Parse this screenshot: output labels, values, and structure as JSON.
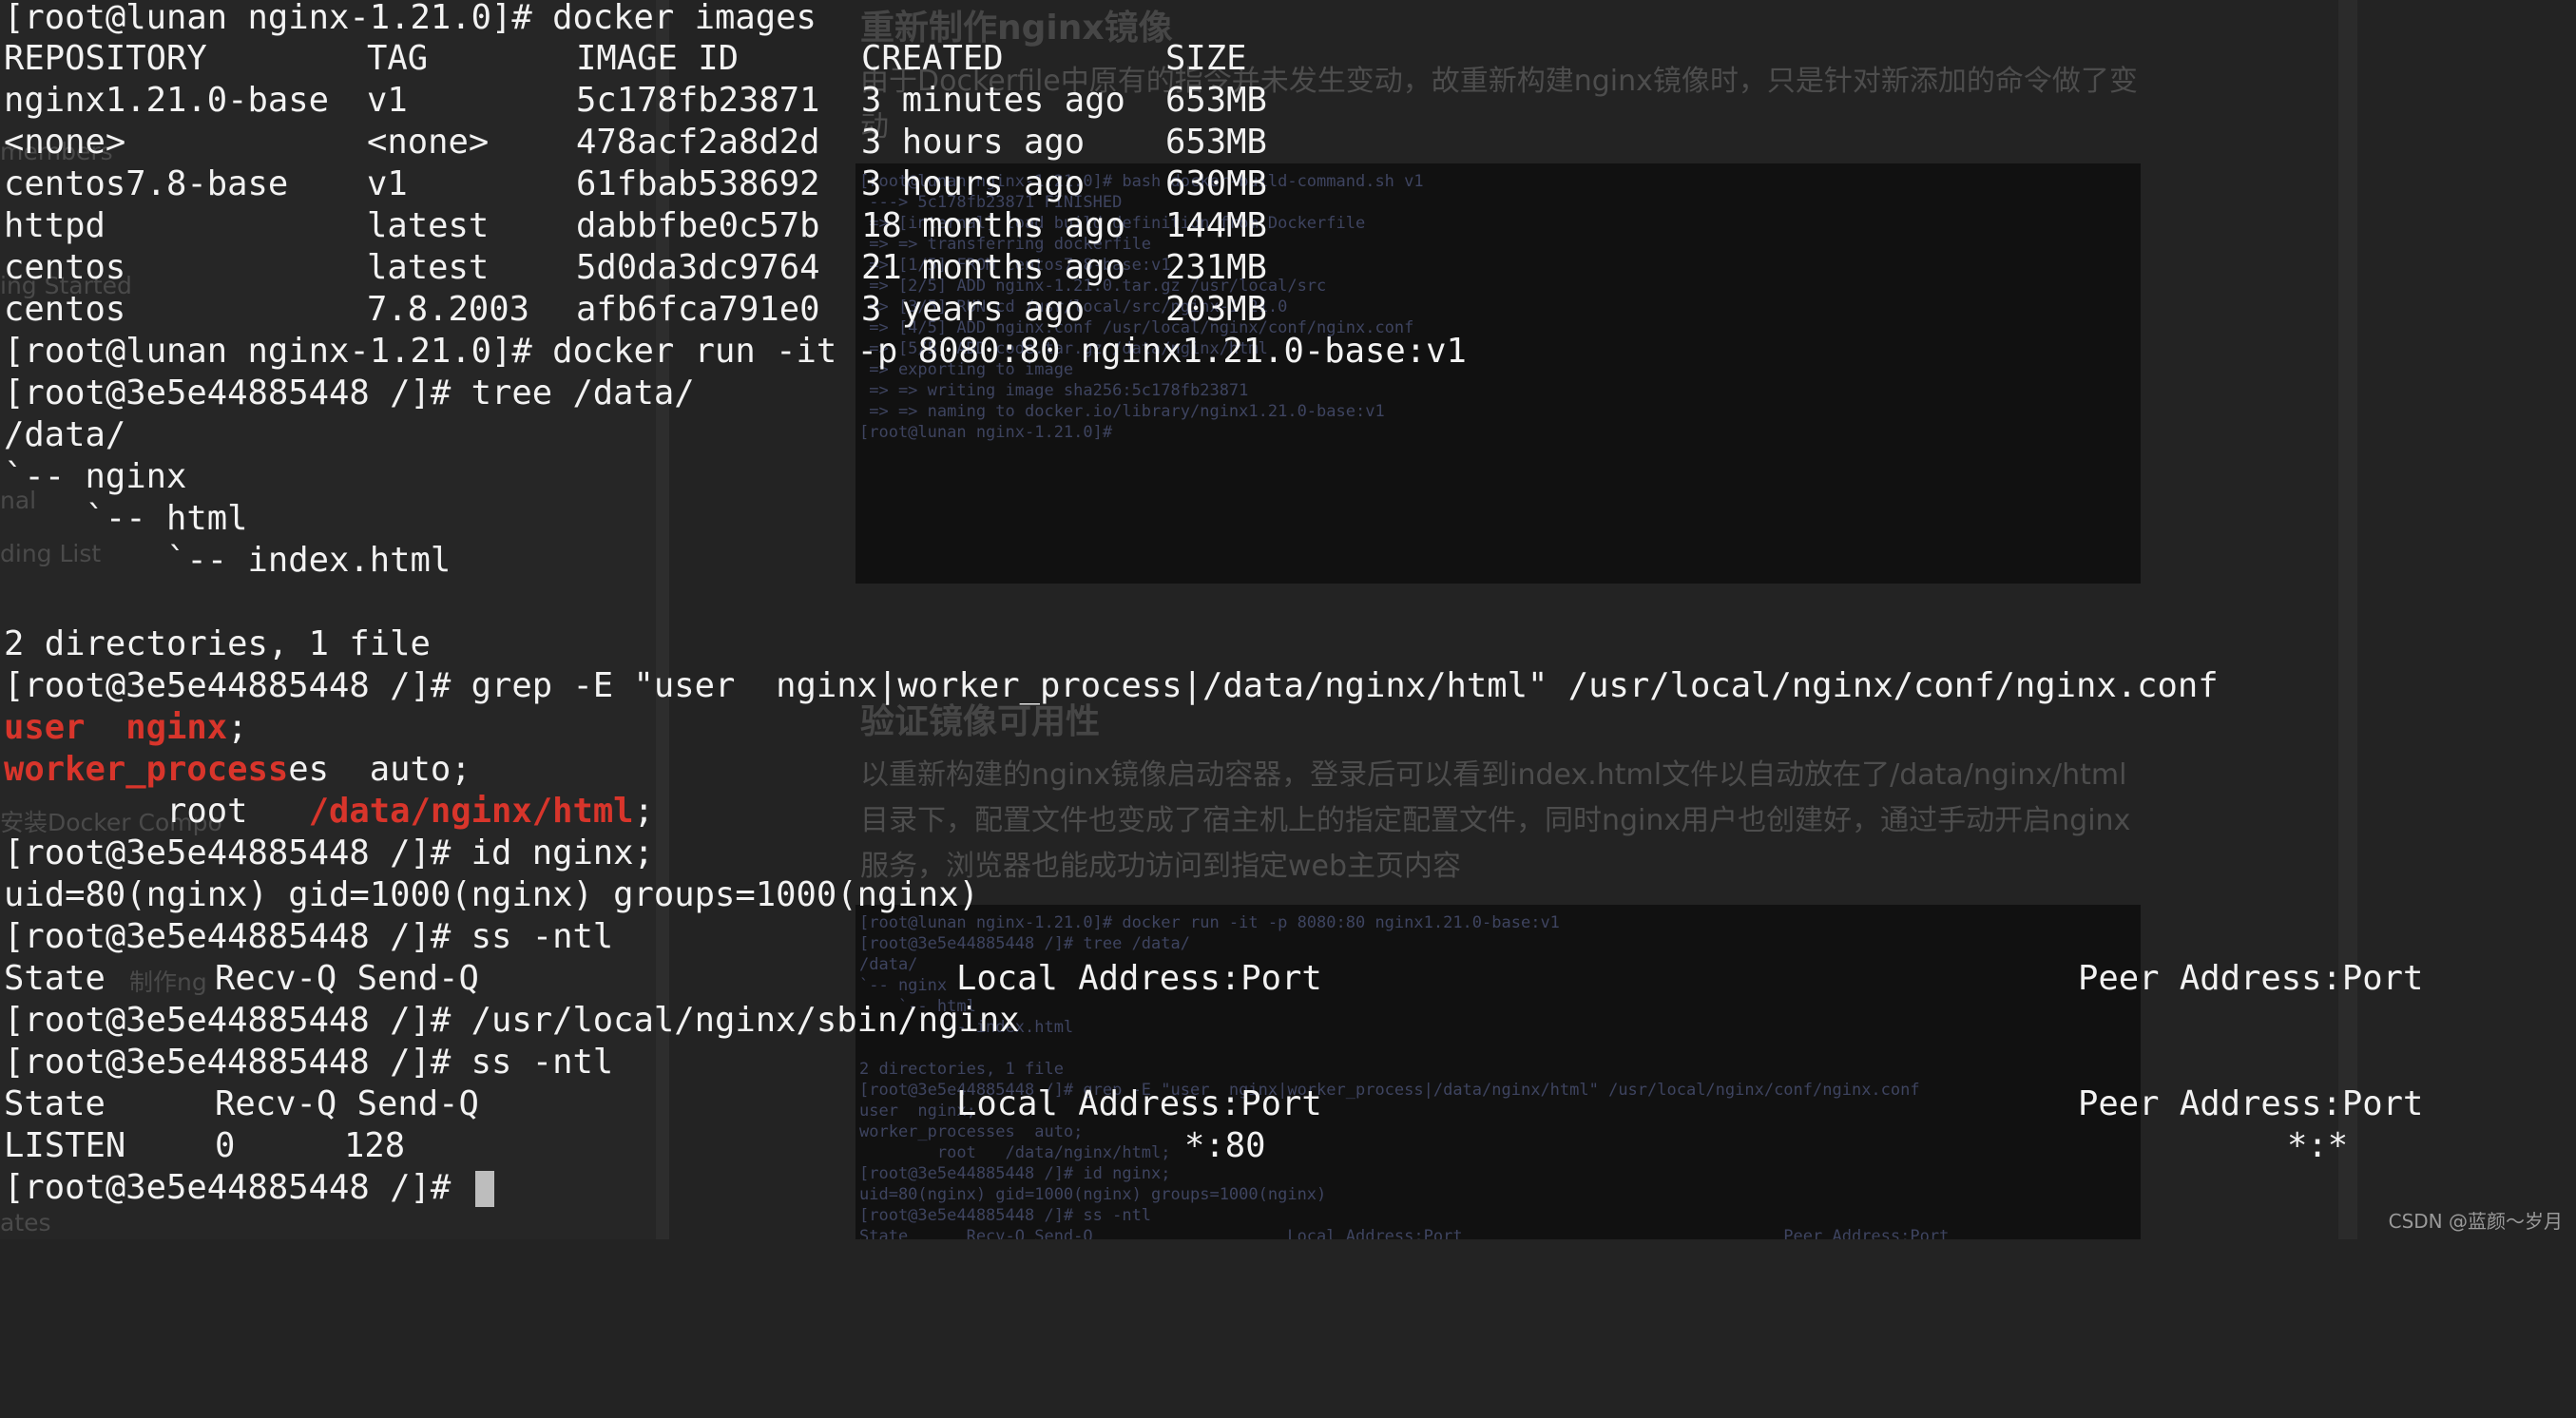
{
  "background_page": {
    "sidebar_items": [
      "members",
      "ing Started",
      "nal",
      "ding List",
      "安装Docker Compo",
      "制作ng",
      "ates"
    ],
    "sections": [
      {
        "title": "重新制作nginx镜像",
        "paragraph": "由于Dockerfile中原有的指令并未发生变动，故重新构建nginx镜像时，只是针对新添加的命令做了变动"
      },
      {
        "title": "验证镜像可用性",
        "paragraph": "以重新构建的nginx镜像启动容器，登录后可以看到index.html文件以自动放在了/data/nginx/html目录下，配置文件也变成了宿主机上的指定配置文件，同时nginx用户也创建好，通过手动开启nginx服务，浏览器也能成功访问到指定web主页内容"
      }
    ],
    "screenshot1_text": "[root@lunan nginx-1.21.0]# bash docker-build-command.sh v1\n ---> 5c178fb23871 FINISHED\n => [internal] load build definition from Dockerfile\n => => transferring dockerfile\n => [1/5] FROM centos7.8-base:v1\n => [2/5] ADD nginx-1.21.0.tar.gz /usr/local/src\n => [3/5] RUN cd /usr/local/src/nginx-1.21.0\n => [4/5] ADD nginx.conf /usr/local/nginx/conf/nginx.conf\n => [5/5] ADD code.tar.gz /data/nginx/html\n => exporting to image\n => => writing image sha256:5c178fb23871\n => => naming to docker.io/library/nginx1.21.0-base:v1\n[root@lunan nginx-1.21.0]#",
    "screenshot2_text": "[root@lunan nginx-1.21.0]# docker run -it -p 8080:80 nginx1.21.0-base:v1\n[root@3e5e44885448 /]# tree /data/\n/data/\n`-- nginx\n    `-- html\n        `-- index.html\n\n2 directories, 1 file\n[root@3e5e44885448 /]# grep -E \"user  nginx|worker_process|/data/nginx/html\" /usr/local/nginx/conf/nginx.conf\nuser  nginx;\nworker_processes  auto;\n        root   /data/nginx/html;\n[root@3e5e44885448 /]# id nginx;\nuid=80(nginx) gid=1000(nginx) groups=1000(nginx)\n[root@3e5e44885448 /]# ss -ntl\nState      Recv-Q Send-Q                    Local Address:Port                                 Peer Address:Port"
  },
  "terminal": {
    "cmd1": "[root@lunan nginx-1.21.0]# docker images",
    "images_header": [
      "REPOSITORY",
      "TAG",
      "IMAGE ID",
      "CREATED",
      "SIZE"
    ],
    "images": [
      [
        "nginx1.21.0-base",
        "v1",
        "5c178fb23871",
        "3 minutes ago",
        "653MB"
      ],
      [
        "<none>",
        "<none>",
        "478acf2a8d2d",
        "3 hours ago",
        "653MB"
      ],
      [
        "centos7.8-base",
        "v1",
        "61fbab538692",
        "3 hours ago",
        "630MB"
      ],
      [
        "httpd",
        "latest",
        "dabbfbe0c57b",
        "18 months ago",
        "144MB"
      ],
      [
        "centos",
        "latest",
        "5d0da3dc9764",
        "21 months ago",
        "231MB"
      ],
      [
        "centos",
        "7.8.2003",
        "afb6fca791e0",
        "3 years ago",
        "203MB"
      ]
    ],
    "cmd2": "[root@lunan nginx-1.21.0]# docker run -it -p 8080:80 nginx1.21.0-base:v1",
    "cmd3": "[root@3e5e44885448 /]# tree /data/",
    "tree": [
      "/data/",
      "`-- nginx",
      "    `-- html",
      "        `-- index.html"
    ],
    "tree_summary": "2 directories, 1 file",
    "cmd4": "[root@3e5e44885448 /]# grep -E \"user  nginx|worker_process|/data/nginx/html\" /usr/local/nginx/conf/nginx.conf",
    "grep_line1_match": "user  nginx",
    "grep_line1_rest": ";",
    "grep_line2_match": "worker_process",
    "grep_line2_rest": "es  auto;",
    "grep_line3_prefix": "        root   ",
    "grep_line3_match": "/data/nginx/html",
    "grep_line3_rest": ";",
    "cmd5": "[root@3e5e44885448 /]# id nginx;",
    "id_output": "uid=80(nginx) gid=1000(nginx) groups=1000(nginx)",
    "cmd6": "[root@3e5e44885448 /]# ss -ntl",
    "ss_header": {
      "state": "State",
      "recvq_sendq": "Recv-Q Send-Q",
      "local": "Local Address:Port",
      "peer": "Peer Address:Port"
    },
    "cmd7": "[root@3e5e44885448 /]# /usr/local/nginx/sbin/nginx",
    "cmd8": "[root@3e5e44885448 /]# ss -ntl",
    "ss_row": {
      "state": "LISTEN",
      "recvq": "0",
      "sendq": "128",
      "local": "*:80",
      "peer": "*:*"
    },
    "prompt_final": "[root@3e5e44885448 /]# "
  },
  "watermark": "CSDN @蓝颜～岁月",
  "colors": {
    "background": "#232323",
    "text": "#f2f2f2",
    "highlight": "#d8352b",
    "cursor": "#bdbdbd"
  }
}
